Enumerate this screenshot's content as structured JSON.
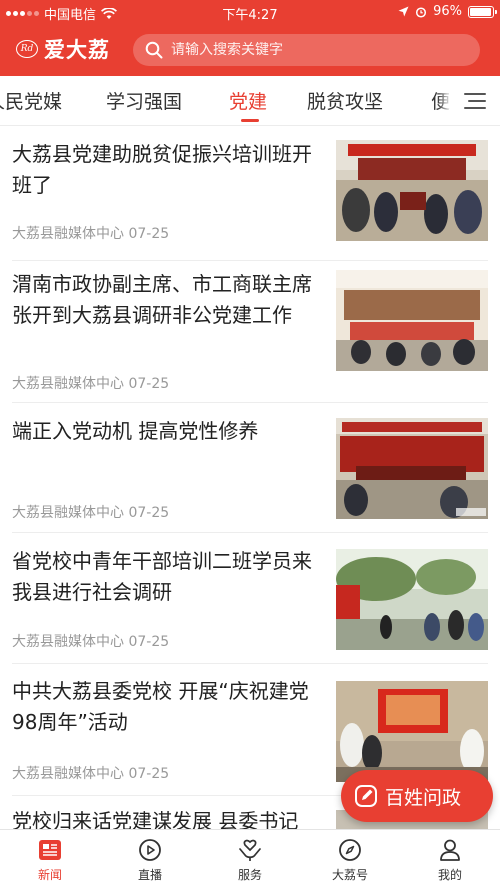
{
  "status_bar": {
    "carrier": "中国电信",
    "time": "下午4:27",
    "battery": "96%",
    "battery_level": 0.96
  },
  "header": {
    "logo_text": "爱大荔",
    "logo_mark": "Rd",
    "search_placeholder": "请输入搜索关键字"
  },
  "tabs": [
    {
      "label": "人民党媒",
      "active": false
    },
    {
      "label": "学习强国",
      "active": false
    },
    {
      "label": "党建",
      "active": true
    },
    {
      "label": "脱贫攻坚",
      "active": false
    },
    {
      "label": "便",
      "active": false
    }
  ],
  "news": [
    {
      "title": "大荔县党建助脱贫促振兴培训班开班了",
      "source": "大荔县融媒体中心",
      "date": "07-25"
    },
    {
      "title": "渭南市政协副主席、市工商联主席张开到大荔县调研非公党建工作",
      "source": "大荔县融媒体中心",
      "date": "07-25"
    },
    {
      "title": "端正入党动机 提高党性修养",
      "source": "大荔县融媒体中心",
      "date": "07-25"
    },
    {
      "title": "省党校中青年干部培训二班学员来我县进行社会调研",
      "source": "大荔县融媒体中心",
      "date": "07-25"
    },
    {
      "title": "中共大荔县委党校 开展“庆祝建党98周年”活动",
      "source": "大荔县融媒体中心",
      "date": "07-25"
    },
    {
      "title": "党校归来话党建谋发展 县委书记",
      "source": "",
      "date": ""
    }
  ],
  "float_button": {
    "label": "百姓问政"
  },
  "bottom_nav": [
    {
      "label": "新闻",
      "active": true
    },
    {
      "label": "直播",
      "active": false
    },
    {
      "label": "服务",
      "active": false
    },
    {
      "label": "大荔号",
      "active": false
    },
    {
      "label": "我的",
      "active": false
    }
  ],
  "colors": {
    "accent": "#e83f32",
    "meta": "#999999"
  }
}
